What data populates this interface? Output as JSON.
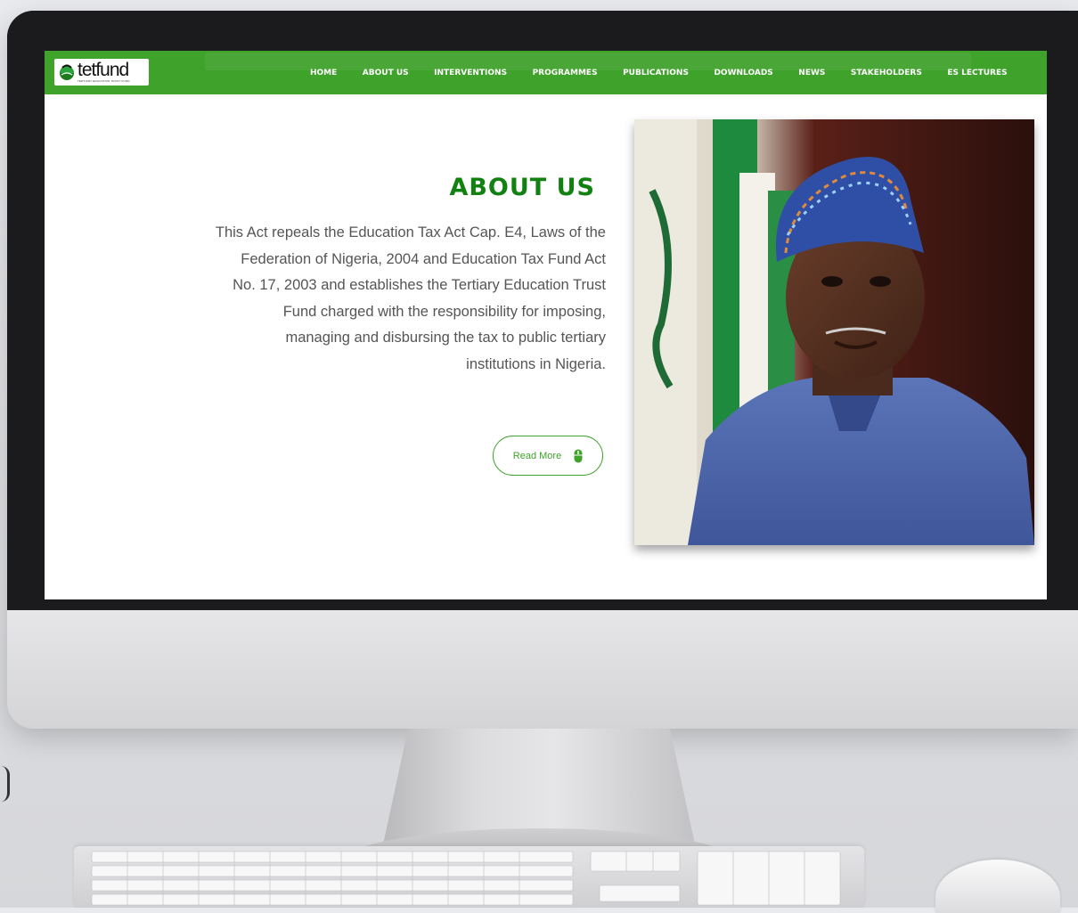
{
  "logo": {
    "text": "tetfund",
    "tagline": "TERTIARY EDUCATION TRUST FUND"
  },
  "nav": {
    "items": [
      "HOME",
      "ABOUT US",
      "INTERVENTIONS",
      "PROGRAMMES",
      "PUBLICATIONS",
      "DOWNLOADS",
      "NEWS",
      "STAKEHOLDERS",
      "ES LECTURES"
    ]
  },
  "about": {
    "title": "ABOUT US",
    "lines": [
      "This Act repeals the Education Tax Act Cap. E4, Laws of the",
      "Federation of Nigeria, 2004 and Education Tax Fund Act",
      "No. 17, 2003 and establishes the Tertiary Education Trust",
      "Fund charged with the responsibility for imposing,",
      "managing and disbursing the tax to public tertiary",
      "institutions in Nigeria."
    ],
    "read_more_label": "Read More",
    "read_more_icon": "mouse-icon"
  },
  "colors": {
    "brand_green": "#3fa22b",
    "title_green": "#118212",
    "body_text": "#555555"
  }
}
